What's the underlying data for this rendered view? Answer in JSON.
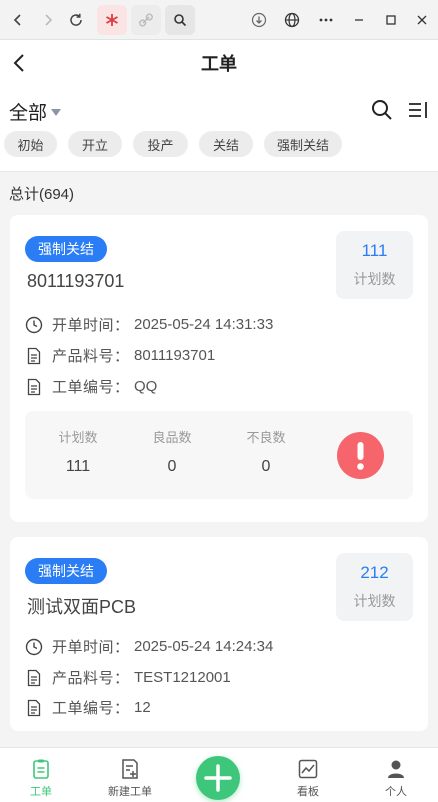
{
  "browser": {
    "icons": [
      "back-icon",
      "forward-icon",
      "reload-icon",
      "extension-icon",
      "link-icon",
      "search-icon",
      "download-icon",
      "globe-icon",
      "more-icon",
      "minimize-icon",
      "maximize-icon",
      "close-icon"
    ]
  },
  "header": {
    "title": "工单"
  },
  "filter": {
    "selected": "全部",
    "chips": [
      "初始",
      "开立",
      "投产",
      "关结",
      "强制关结"
    ]
  },
  "total": "总计(694)",
  "cards": [
    {
      "status": "强制关结",
      "name": "8011193701",
      "plan_value": "111",
      "plan_label": "计划数",
      "rows": [
        {
          "label": "开单时间：",
          "value": "2025-05-24 14:31:33",
          "icon": "clock-icon"
        },
        {
          "label": "产品料号：",
          "value": "8011193701",
          "icon": "document-icon"
        },
        {
          "label": "工单编号：",
          "value": "QQ",
          "icon": "document-icon"
        }
      ],
      "stats": [
        {
          "label": "计划数",
          "value": "111"
        },
        {
          "label": "良品数",
          "value": "0"
        },
        {
          "label": "不良数",
          "value": "0"
        }
      ]
    },
    {
      "status": "强制关结",
      "name": "测试双面PCB",
      "plan_value": "212",
      "plan_label": "计划数",
      "rows": [
        {
          "label": "开单时间：",
          "value": "2025-05-24 14:24:34",
          "icon": "clock-icon"
        },
        {
          "label": "产品料号：",
          "value": "TEST1212001",
          "icon": "document-icon"
        },
        {
          "label": "工单编号：",
          "value": "12",
          "icon": "document-icon"
        }
      ]
    }
  ],
  "nav": {
    "items": [
      "工单",
      "新建工单",
      "看板",
      "个人"
    ]
  },
  "colors": {
    "accent": "#2a7df4",
    "green": "#3ec77b",
    "alert": "#f7656c"
  }
}
